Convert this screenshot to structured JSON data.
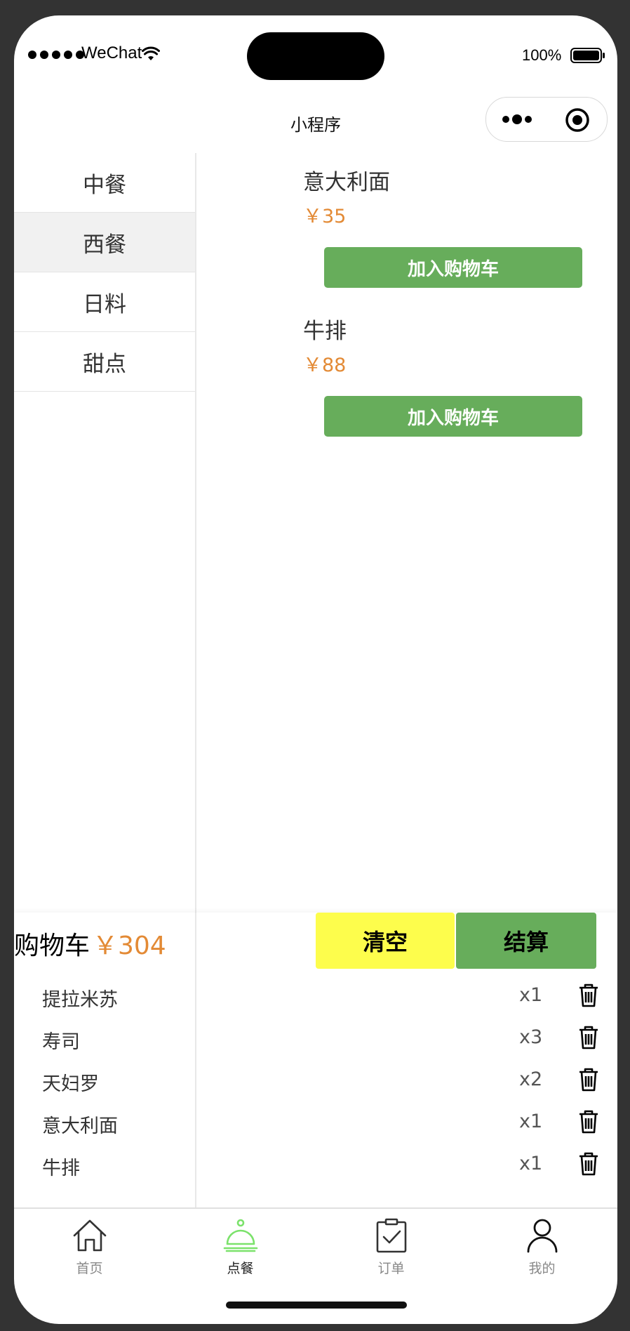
{
  "status_bar": {
    "carrier": "WeChat",
    "battery": "100%"
  },
  "nav": {
    "title": "小程序"
  },
  "categories": [
    {
      "label": "中餐",
      "active": false
    },
    {
      "label": "西餐",
      "active": true
    },
    {
      "label": "日料",
      "active": false
    },
    {
      "label": "甜点",
      "active": false
    }
  ],
  "dishes": [
    {
      "name": "意大利面",
      "price": "￥35",
      "button": "加入购物车"
    },
    {
      "name": "牛排",
      "price": "￥88",
      "button": "加入购物车"
    }
  ],
  "cart": {
    "title": "购物车",
    "total": "￥304",
    "clear_label": "清空",
    "checkout_label": "结算",
    "items": [
      {
        "name": "提拉米苏",
        "qty": "x1"
      },
      {
        "name": "寿司",
        "qty": "x3"
      },
      {
        "name": "天妇罗",
        "qty": "x2"
      },
      {
        "name": "意大利面",
        "qty": "x1"
      },
      {
        "name": "牛排",
        "qty": "x1"
      }
    ]
  },
  "tabs": [
    {
      "label": "首页",
      "icon": "home-icon",
      "active": false
    },
    {
      "label": "点餐",
      "icon": "dining-bell-icon",
      "active": true
    },
    {
      "label": "订单",
      "icon": "clipboard-check-icon",
      "active": false
    },
    {
      "label": "我的",
      "icon": "user-icon",
      "active": false
    }
  ],
  "colors": {
    "price": "#e38a35",
    "primary_green": "#67ad5b",
    "clear_yellow": "#fdfd4c",
    "active_tab_green": "#7be26b"
  }
}
